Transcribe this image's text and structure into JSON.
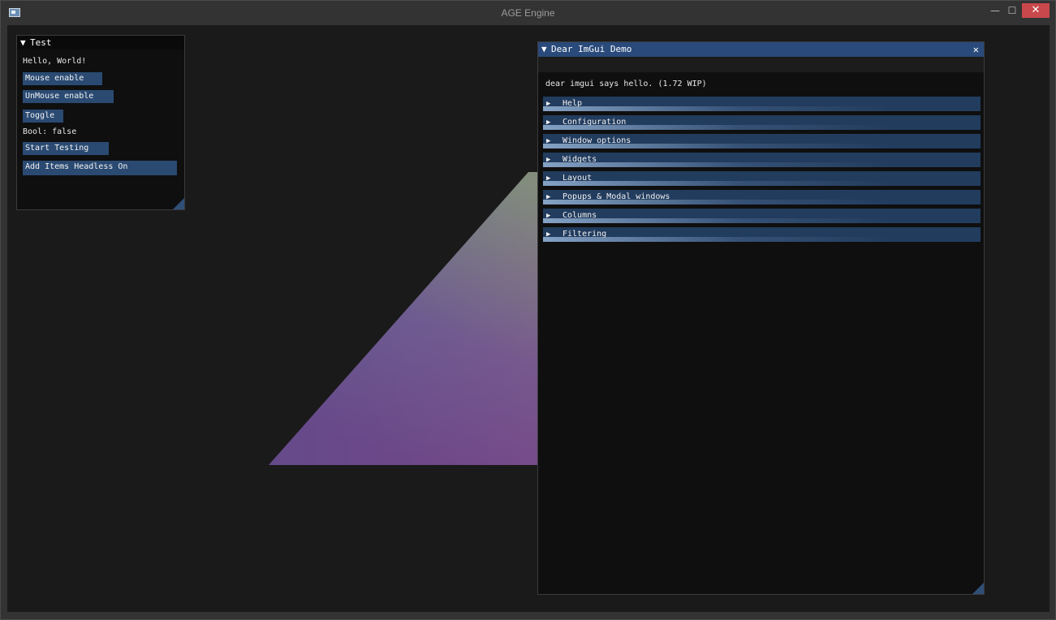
{
  "window": {
    "title": "AGE Engine",
    "controls": {
      "minimize": "—",
      "maximize": "☐",
      "close": "✕"
    }
  },
  "scene": {
    "triangle_colors": [
      "#7fc07a",
      "#5a4a8c",
      "#8a3a80"
    ]
  },
  "test_window": {
    "title": "Test",
    "hello_text": "Hello, World!",
    "buttons": {
      "mouse_enable": "Mouse enable",
      "unmouse_enable": "UnMouse enable",
      "toggle": "Toggle",
      "start_testing": "Start Testing",
      "add_item": "Add Items Headless On"
    },
    "bool_text": "Bool: false"
  },
  "demo_window": {
    "title": "Dear ImGui Demo",
    "close_icon": "✕",
    "intro_text": "dear imgui says hello. (1.72 WIP)",
    "headers": [
      {
        "label": "Help"
      },
      {
        "label": "Configuration"
      },
      {
        "label": "Window options"
      },
      {
        "label": "Widgets"
      },
      {
        "label": "Layout"
      },
      {
        "label": "Popups & Modal windows"
      },
      {
        "label": "Columns"
      },
      {
        "label": "Filtering"
      }
    ]
  },
  "colors": {
    "imgui_title_bg_active": "#294a7a",
    "imgui_title_bg": "#0a0a0a",
    "imgui_button": "#2a4a72",
    "imgui_header": "#223c5e",
    "viewport_bg": "#1a1a1a"
  }
}
